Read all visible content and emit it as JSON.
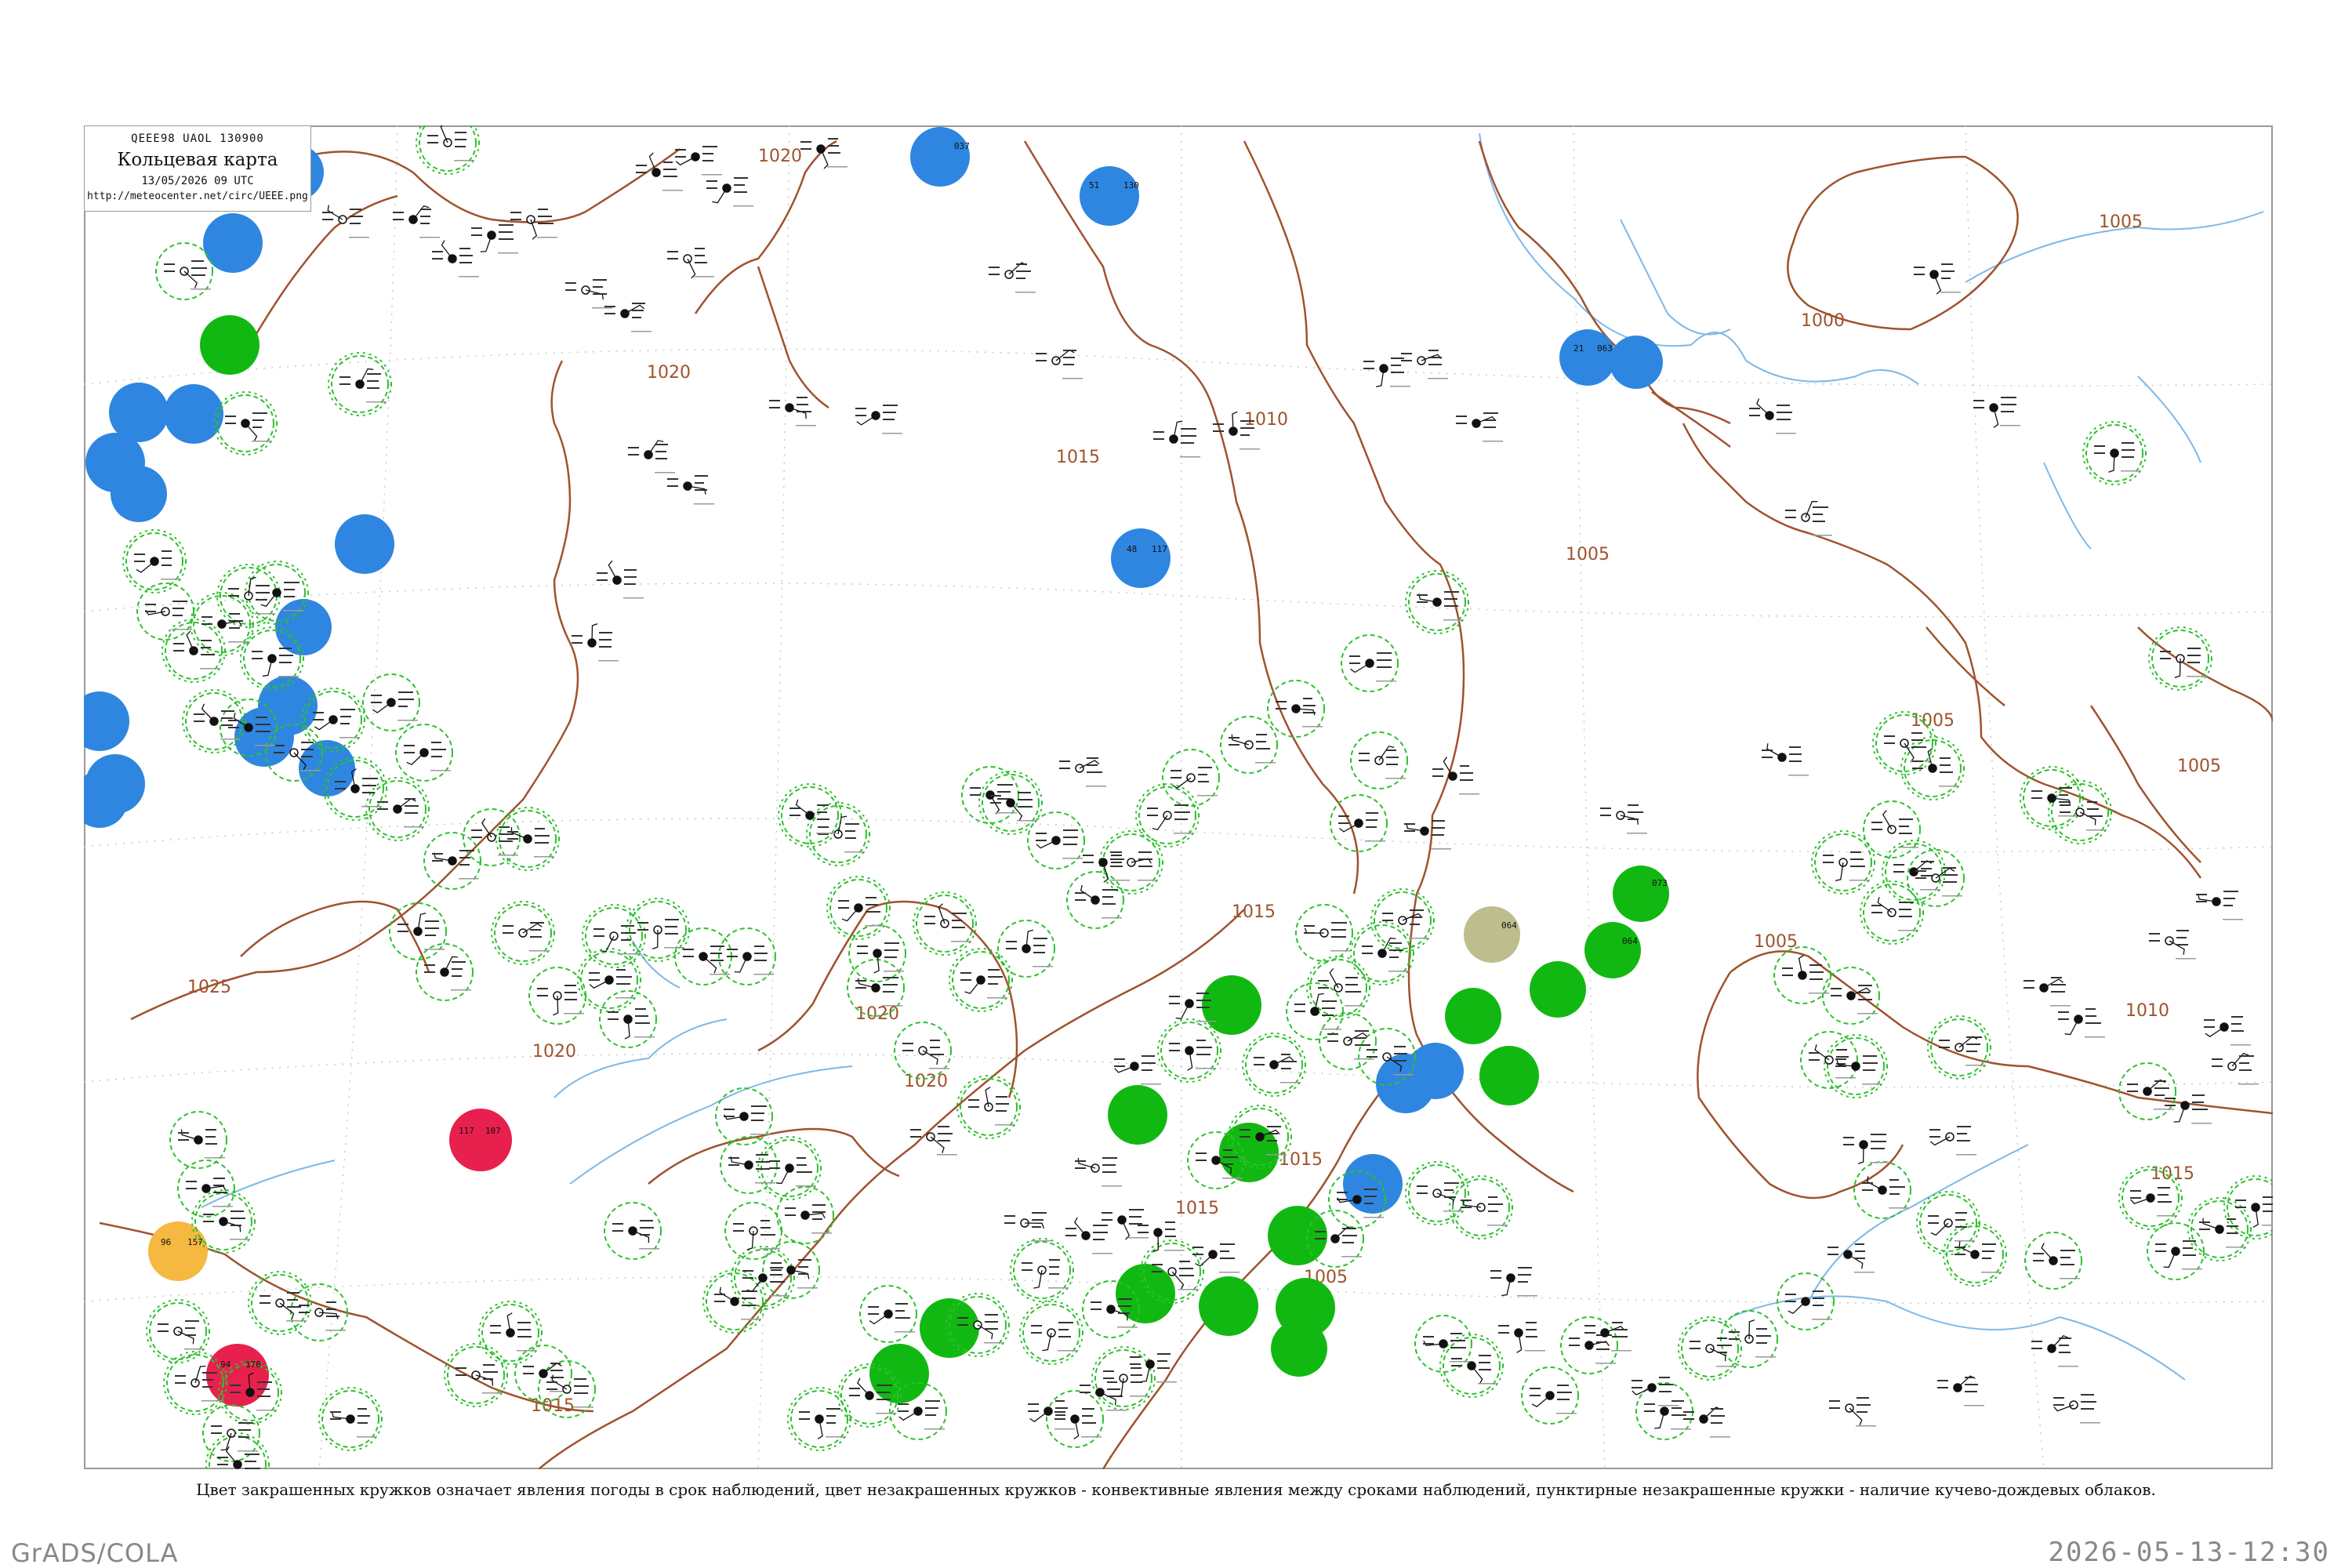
{
  "header": {
    "code": "QEEE98  UAOL  130900",
    "title": "Кольцевая карта",
    "time": "13/05/2026 09 UTC",
    "url": "http://meteocenter.net/circ/UEEE.png"
  },
  "legend_note": "Цвет закрашенных кружков означает явления погоды в срок наблюдений, цвет незакрашенных кружков - конвективные явления между сроками наблюдений, пунктирные незакрашенные кружки - наличие кучево-дождевых облаков.",
  "footer": {
    "left": "GrADS/COLA",
    "right": "2026-05-13-12:30"
  },
  "colors": {
    "isobar": "#a0522d",
    "river": "#7fb8e6",
    "coast": "#7fb8e6",
    "grid": "#bbbbbb",
    "fill_blue": "#2e86e0",
    "fill_green": "#12b812",
    "fill_red": "#e8204e",
    "fill_orange": "#f5b840",
    "fill_olive": "#bdbd8e",
    "ring_green": "#2ec02e"
  },
  "isobar_labels": [
    {
      "text": "1020"
    },
    {
      "text": "1020"
    },
    {
      "text": "1015"
    },
    {
      "text": "1010"
    },
    {
      "text": "1005"
    },
    {
      "text": "1000"
    },
    {
      "text": "1005"
    },
    {
      "text": "1005"
    },
    {
      "text": "1005"
    },
    {
      "text": "1010"
    },
    {
      "text": "1015"
    },
    {
      "text": "1015"
    },
    {
      "text": "1025"
    },
    {
      "text": "1020"
    },
    {
      "text": "1020"
    },
    {
      "text": "1015"
    },
    {
      "text": "1020"
    },
    {
      "text": "1015"
    },
    {
      "text": "1005"
    },
    {
      "text": "1005"
    },
    {
      "text": "1015"
    }
  ],
  "stations": [
    {
      "id": "blue-1",
      "kind": "fill_blue",
      "pressure": "037",
      "temp": "-",
      "name": ""
    },
    {
      "id": "blue-2",
      "kind": "fill_blue",
      "pressure": "130",
      "temp": "51",
      "name": ""
    },
    {
      "id": "blue-3",
      "kind": "fill_blue",
      "pressure": "117",
      "temp": "48",
      "name": ""
    },
    {
      "id": "blue-4",
      "kind": "fill_blue",
      "pressure": "063",
      "temp": "21",
      "name": ""
    },
    {
      "id": "green-1",
      "kind": "fill_green",
      "pressure": "073",
      "temp": "",
      "name": ""
    },
    {
      "id": "green-2",
      "kind": "fill_green",
      "pressure": "064",
      "temp": "",
      "name": ""
    },
    {
      "id": "red-1",
      "kind": "fill_red",
      "pressure": "107",
      "temp": "117",
      "name": ""
    },
    {
      "id": "red-2",
      "kind": "fill_red",
      "pressure": "170",
      "temp": "94",
      "name": ""
    },
    {
      "id": "orange-1",
      "kind": "fill_orange",
      "pressure": "157",
      "temp": "96",
      "name": ""
    },
    {
      "id": "olive-1",
      "kind": "fill_olive",
      "pressure": "064",
      "temp": "",
      "name": ""
    }
  ]
}
